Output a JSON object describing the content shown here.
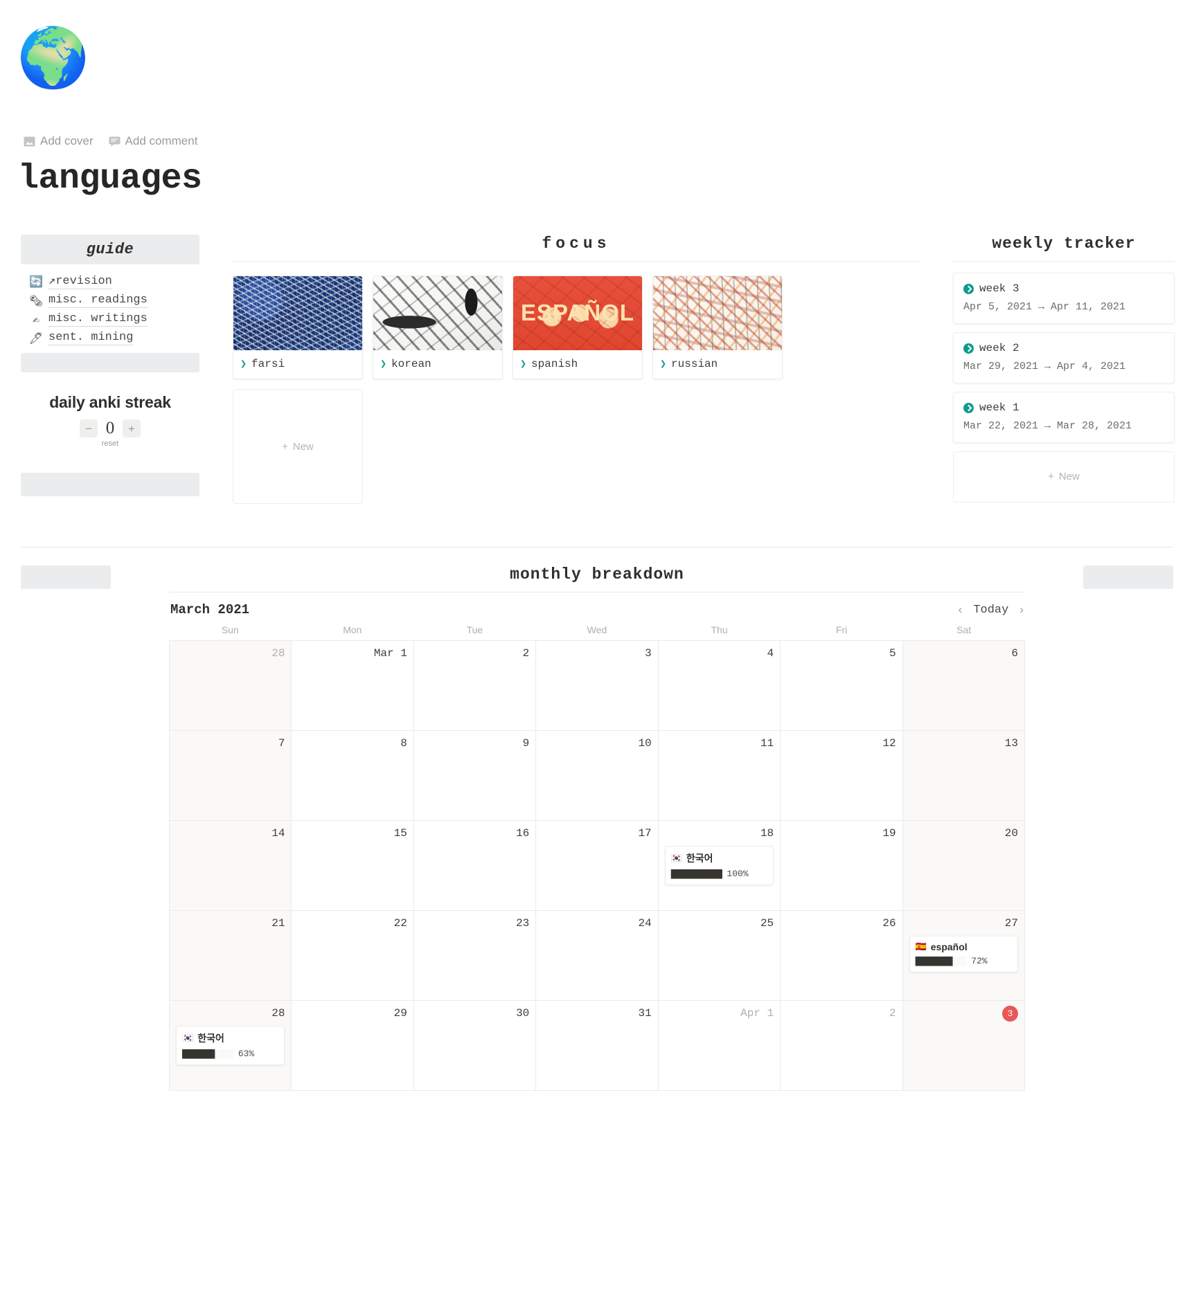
{
  "header": {
    "emoji": "🌍",
    "add_cover_label": "Add cover",
    "add_comment_label": "Add comment",
    "title": "languages"
  },
  "sidebar": {
    "guide": {
      "title": "guide",
      "items": [
        {
          "emoji": "🔄",
          "label": "↗revision"
        },
        {
          "emoji": "🗞",
          "label": "misc. readings"
        },
        {
          "emoji": "✍",
          "label": "misc. writings"
        },
        {
          "emoji": "🖊",
          "label": "sent. mining"
        }
      ]
    },
    "counter": {
      "title": "daily anki streak",
      "minus_label": "−",
      "plus_label": "+",
      "value": "0",
      "reset_label": "reset"
    }
  },
  "focus": {
    "heading": "focus",
    "cards": [
      {
        "label": "farsi",
        "art": "art-farsi"
      },
      {
        "label": "korean",
        "art": "art-korean"
      },
      {
        "label": "spanish",
        "art": "art-spanish"
      },
      {
        "label": "russian",
        "art": "art-russian"
      }
    ],
    "new_label": "New"
  },
  "weekly_tracker": {
    "heading": "weekly tracker",
    "weeks": [
      {
        "title": "week 3",
        "dates": "Apr 5, 2021 → Apr 11, 2021"
      },
      {
        "title": "week 2",
        "dates": "Mar 29, 2021 → Apr 4, 2021"
      },
      {
        "title": "week 1",
        "dates": "Mar 22, 2021 → Mar 28, 2021"
      }
    ],
    "new_label": "New"
  },
  "calendar": {
    "heading": "monthly breakdown",
    "month_label": "March 2021",
    "today_label": "Today",
    "prev_label": "‹",
    "next_label": "›",
    "day_names": [
      "Sun",
      "Mon",
      "Tue",
      "Wed",
      "Thu",
      "Fri",
      "Sat"
    ],
    "weeks": [
      [
        {
          "num": "28",
          "muted": true,
          "weekend": true
        },
        {
          "num": "Mar 1",
          "muted": false,
          "weekend": false
        },
        {
          "num": "2",
          "muted": false,
          "weekend": false
        },
        {
          "num": "3",
          "muted": false,
          "weekend": false
        },
        {
          "num": "4",
          "muted": false,
          "weekend": false
        },
        {
          "num": "5",
          "muted": false,
          "weekend": false
        },
        {
          "num": "6",
          "muted": false,
          "weekend": true
        }
      ],
      [
        {
          "num": "7",
          "muted": false,
          "weekend": true
        },
        {
          "num": "8",
          "muted": false,
          "weekend": false
        },
        {
          "num": "9",
          "muted": false,
          "weekend": false
        },
        {
          "num": "10",
          "muted": false,
          "weekend": false
        },
        {
          "num": "11",
          "muted": false,
          "weekend": false
        },
        {
          "num": "12",
          "muted": false,
          "weekend": false
        },
        {
          "num": "13",
          "muted": false,
          "weekend": true
        }
      ],
      [
        {
          "num": "14",
          "muted": false,
          "weekend": true
        },
        {
          "num": "15",
          "muted": false,
          "weekend": false
        },
        {
          "num": "16",
          "muted": false,
          "weekend": false
        },
        {
          "num": "17",
          "muted": false,
          "weekend": false
        },
        {
          "num": "18",
          "muted": false,
          "weekend": false,
          "event": {
            "emoji": "🇰🇷",
            "title": "한국어",
            "percent": 100,
            "percent_label": "100%"
          }
        },
        {
          "num": "19",
          "muted": false,
          "weekend": false
        },
        {
          "num": "20",
          "muted": false,
          "weekend": true
        }
      ],
      [
        {
          "num": "21",
          "muted": false,
          "weekend": true
        },
        {
          "num": "22",
          "muted": false,
          "weekend": false
        },
        {
          "num": "23",
          "muted": false,
          "weekend": false
        },
        {
          "num": "24",
          "muted": false,
          "weekend": false
        },
        {
          "num": "25",
          "muted": false,
          "weekend": false
        },
        {
          "num": "26",
          "muted": false,
          "weekend": false
        },
        {
          "num": "27",
          "muted": false,
          "weekend": true,
          "event": {
            "emoji": "🇪🇸",
            "title": "español",
            "percent": 72,
            "percent_label": "72%"
          }
        }
      ],
      [
        {
          "num": "28",
          "muted": false,
          "weekend": true,
          "event": {
            "emoji": "🇰🇷",
            "title": "한국어",
            "percent": 63,
            "percent_label": "63%"
          }
        },
        {
          "num": "29",
          "muted": false,
          "weekend": false
        },
        {
          "num": "30",
          "muted": false,
          "weekend": false
        },
        {
          "num": "31",
          "muted": false,
          "weekend": false
        },
        {
          "num": "Apr 1",
          "muted": true,
          "weekend": false
        },
        {
          "num": "2",
          "muted": true,
          "weekend": false
        },
        {
          "num": "3",
          "muted": false,
          "weekend": true,
          "today": true
        }
      ]
    ]
  },
  "colors": {
    "accent_teal": "#0f9b8e",
    "today_red": "#eb5757",
    "callout_gray": "#ebeced"
  }
}
